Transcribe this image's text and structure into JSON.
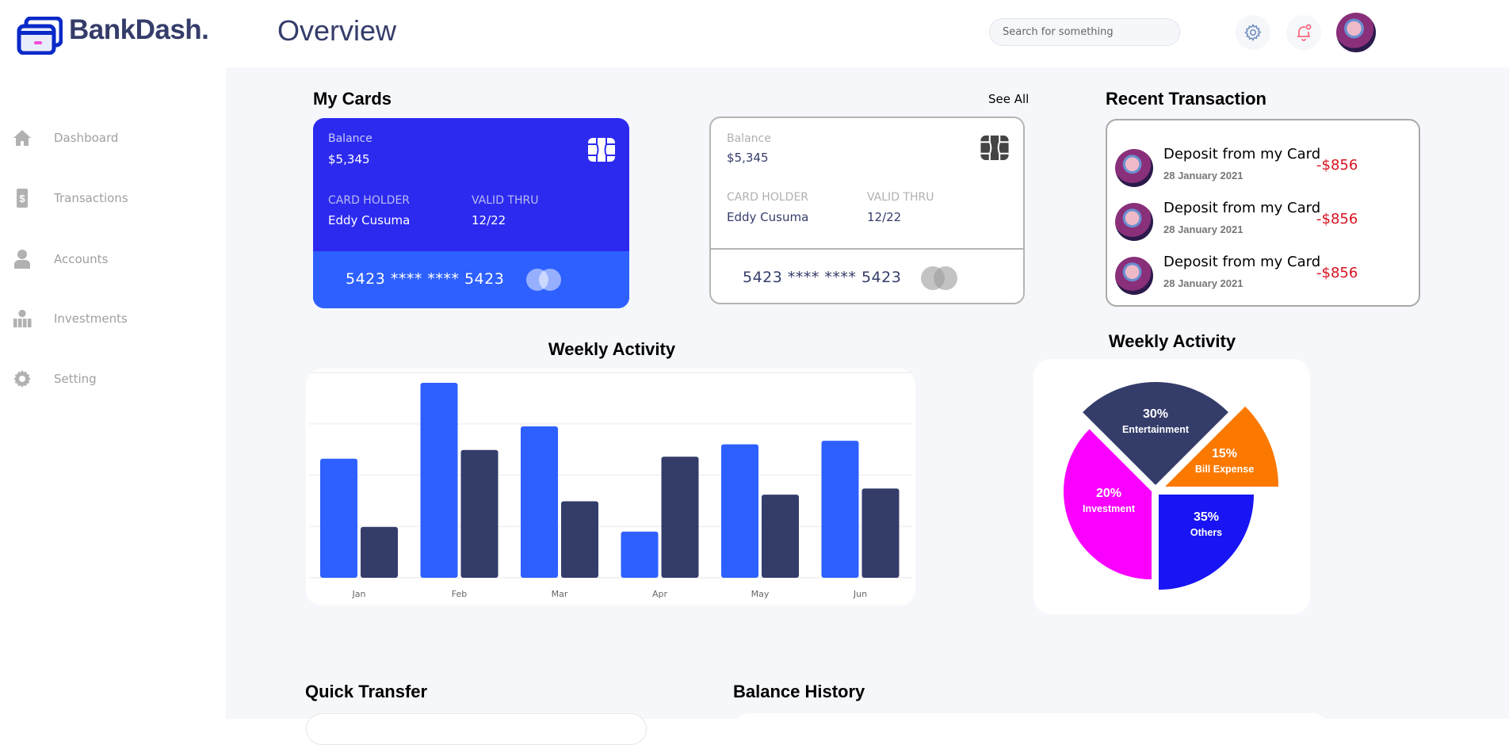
{
  "header": {
    "brand": "BankDash.",
    "title": "Overview",
    "search_placeholder": "Search for something",
    "icons": [
      "settings-icon",
      "notification-bell-icon",
      "user-avatar"
    ]
  },
  "sidebar": {
    "items": [
      {
        "label": "Dashboard",
        "icon": "home-icon"
      },
      {
        "label": "Transactions",
        "icon": "transactions-icon"
      },
      {
        "label": "Accounts",
        "icon": "user-icon"
      },
      {
        "label": "Investments",
        "icon": "investments-icon"
      },
      {
        "label": "Setting",
        "icon": "gear-icon"
      }
    ]
  },
  "my_cards": {
    "title": "My Cards",
    "see_all": "See All",
    "cards": [
      {
        "balance_label": "Balance",
        "balance": "$5,345",
        "holder_label": "CARD HOLDER",
        "holder": "Eddy Cusuma",
        "valid_label": "VALID THRU",
        "valid": "12/22",
        "number": "5423 **** **** 5423",
        "style": "blue"
      },
      {
        "balance_label": "Balance",
        "balance": "$5,345",
        "holder_label": "CARD HOLDER",
        "holder": "Eddy Cusuma",
        "valid_label": "VALID THRU",
        "valid": "12/22",
        "number": "5423 **** **** 5423",
        "style": "white"
      }
    ]
  },
  "recent_transactions": {
    "title": "Recent Transaction",
    "items": [
      {
        "title": "Deposit from my Card",
        "date": "28 January 2021",
        "amount": "-$856"
      },
      {
        "title": "Deposit from my Card",
        "date": "28 January 2021",
        "amount": "-$856"
      },
      {
        "title": "Deposit from my Card",
        "date": "28 January 2021",
        "amount": "-$856"
      }
    ]
  },
  "sections": {
    "quick_transfer": "Quick Transfer",
    "balance_history": "Balance History"
  },
  "colors": {
    "card_blue_top": "#2d2af0",
    "card_blue_bottom": "#2d60ff",
    "bar_primary": "#2d60ff",
    "bar_secondary": "#343c6a",
    "negative_amount": "#d8131f"
  },
  "chart_data": [
    {
      "type": "bar",
      "title": "Weekly Activity",
      "categories": [
        "Jan",
        "Feb",
        "Mar",
        "Apr",
        "May",
        "Jun"
      ],
      "series": [
        {
          "values": [
            232,
            380,
            295,
            90,
            260,
            267
          ],
          "color": "#2d60ff"
        },
        {
          "values": [
            99,
            249,
            149,
            236,
            162,
            174
          ],
          "color": "#343c6a"
        }
      ],
      "ylim": [
        0,
        400
      ],
      "grid": true,
      "xlabel": "",
      "ylabel": ""
    },
    {
      "type": "pie",
      "title": "Weekly Activity",
      "slices": [
        {
          "label": "Entertainment",
          "value": 30,
          "text": "30%",
          "color": "#343c6a"
        },
        {
          "label": "Bill Expense",
          "value": 15,
          "text": "15%",
          "color": "#fc7900"
        },
        {
          "label": "Investment",
          "value": 20,
          "text": "20%",
          "color": "#fa00ff"
        },
        {
          "label": "Others",
          "value": 35,
          "text": "35%",
          "color": "#1814f3"
        }
      ]
    }
  ]
}
